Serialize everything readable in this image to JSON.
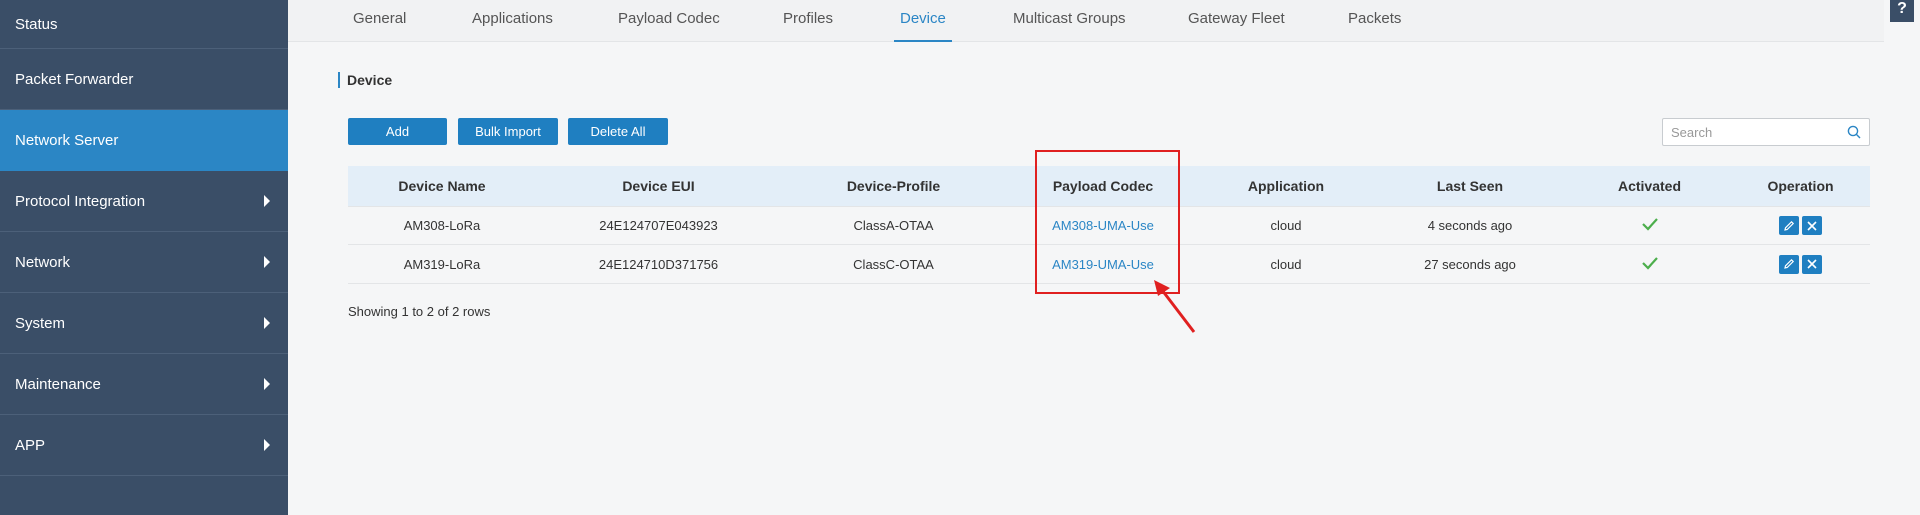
{
  "sidebar": {
    "items": [
      {
        "label": "Status"
      },
      {
        "label": "Packet Forwarder"
      },
      {
        "label": "Network Server"
      },
      {
        "label": "Protocol Integration"
      },
      {
        "label": "Network"
      },
      {
        "label": "System"
      },
      {
        "label": "Maintenance"
      },
      {
        "label": "APP"
      }
    ]
  },
  "tabs": [
    "General",
    "Applications",
    "Payload Codec",
    "Profiles",
    "Device",
    "Multicast Groups",
    "Gateway Fleet",
    "Packets"
  ],
  "help": "?",
  "section": {
    "title": "Device"
  },
  "toolbar": {
    "add": "Add",
    "bulk_import": "Bulk Import",
    "delete_all": "Delete All"
  },
  "search": {
    "placeholder": "Search"
  },
  "table": {
    "headers": [
      "Device Name",
      "Device EUI",
      "Device-Profile",
      "Payload Codec",
      "Application",
      "Last Seen",
      "Activated",
      "Operation"
    ],
    "rows": [
      {
        "name": "AM308-LoRa",
        "eui": "24E124707E043923",
        "profile": "ClassA-OTAA",
        "codec": "AM308-UMA-Use",
        "application": "cloud",
        "last_seen": "4 seconds ago",
        "activated": true
      },
      {
        "name": "AM319-LoRa",
        "eui": "24E124710D371756",
        "profile": "ClassC-OTAA",
        "codec": "AM319-UMA-Use",
        "application": "cloud",
        "last_seen": "27 seconds ago",
        "activated": true
      }
    ]
  },
  "footer": {
    "pagination": "Showing 1 to 2 of 2 rows"
  },
  "colors": {
    "sidebar": "#3a4e67",
    "accent": "#2b86c5",
    "button": "#1f7fc1",
    "success": "#4cae4c",
    "annotation": "#e02020"
  }
}
